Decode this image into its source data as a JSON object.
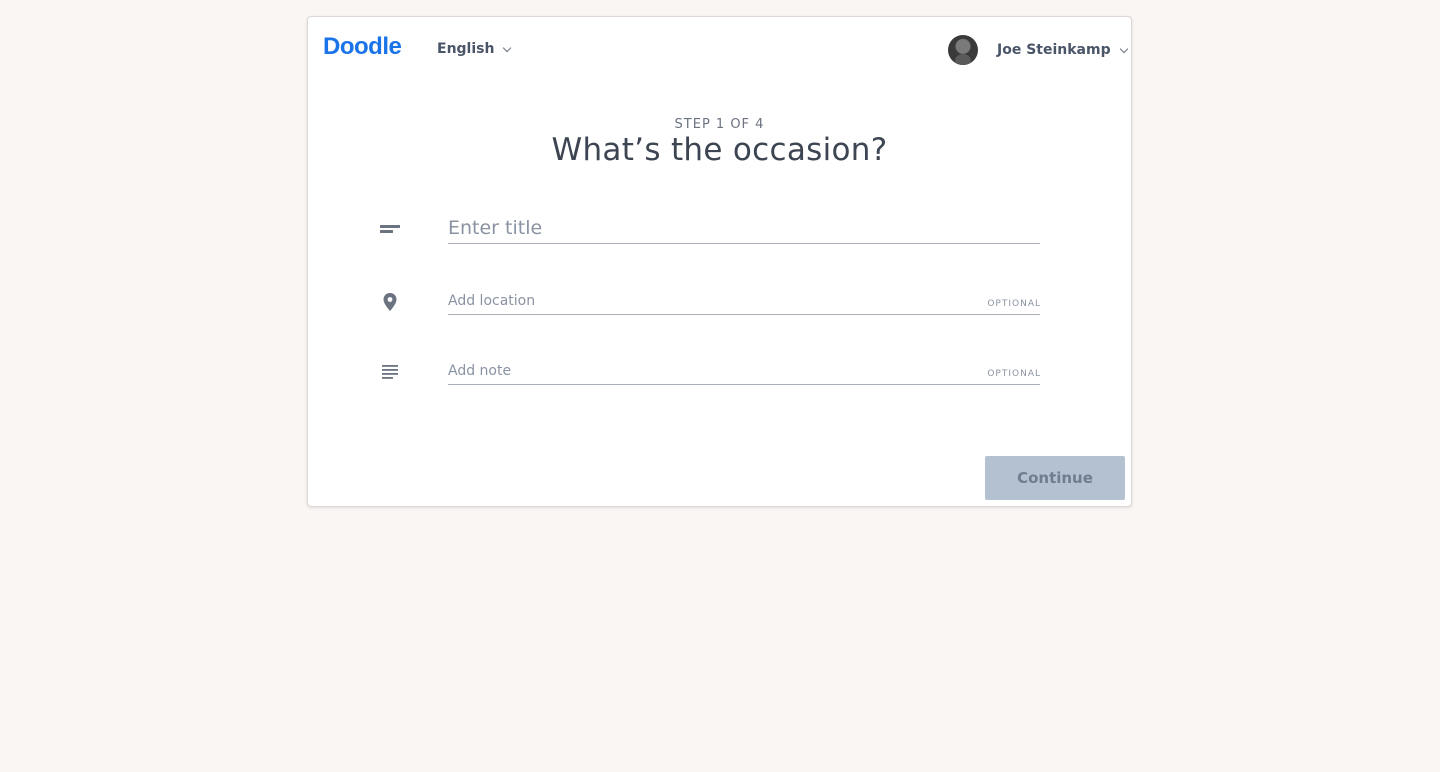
{
  "header": {
    "logo": "Doodle",
    "language": "English",
    "user_name": "Joe Steinkamp"
  },
  "wizard": {
    "step": "STEP 1 OF 4",
    "heading": "What’s the occasion?"
  },
  "form": {
    "title_placeholder": "Enter title",
    "title_value": "",
    "location_placeholder": "Add location",
    "location_value": "",
    "location_tag": "OPTIONAL",
    "note_placeholder": "Add note",
    "note_value": "",
    "note_tag": "OPTIONAL"
  },
  "actions": {
    "continue_label": "Continue"
  },
  "icons": {
    "title": "title-lines-icon",
    "location": "location-pin-icon",
    "note": "note-lines-icon",
    "dropdown": "chevron-down-icon"
  },
  "colors": {
    "brand": "#1a73e8",
    "background": "#faf6f3",
    "button_disabled": "#b4c1d1",
    "text": "#4a5568"
  }
}
